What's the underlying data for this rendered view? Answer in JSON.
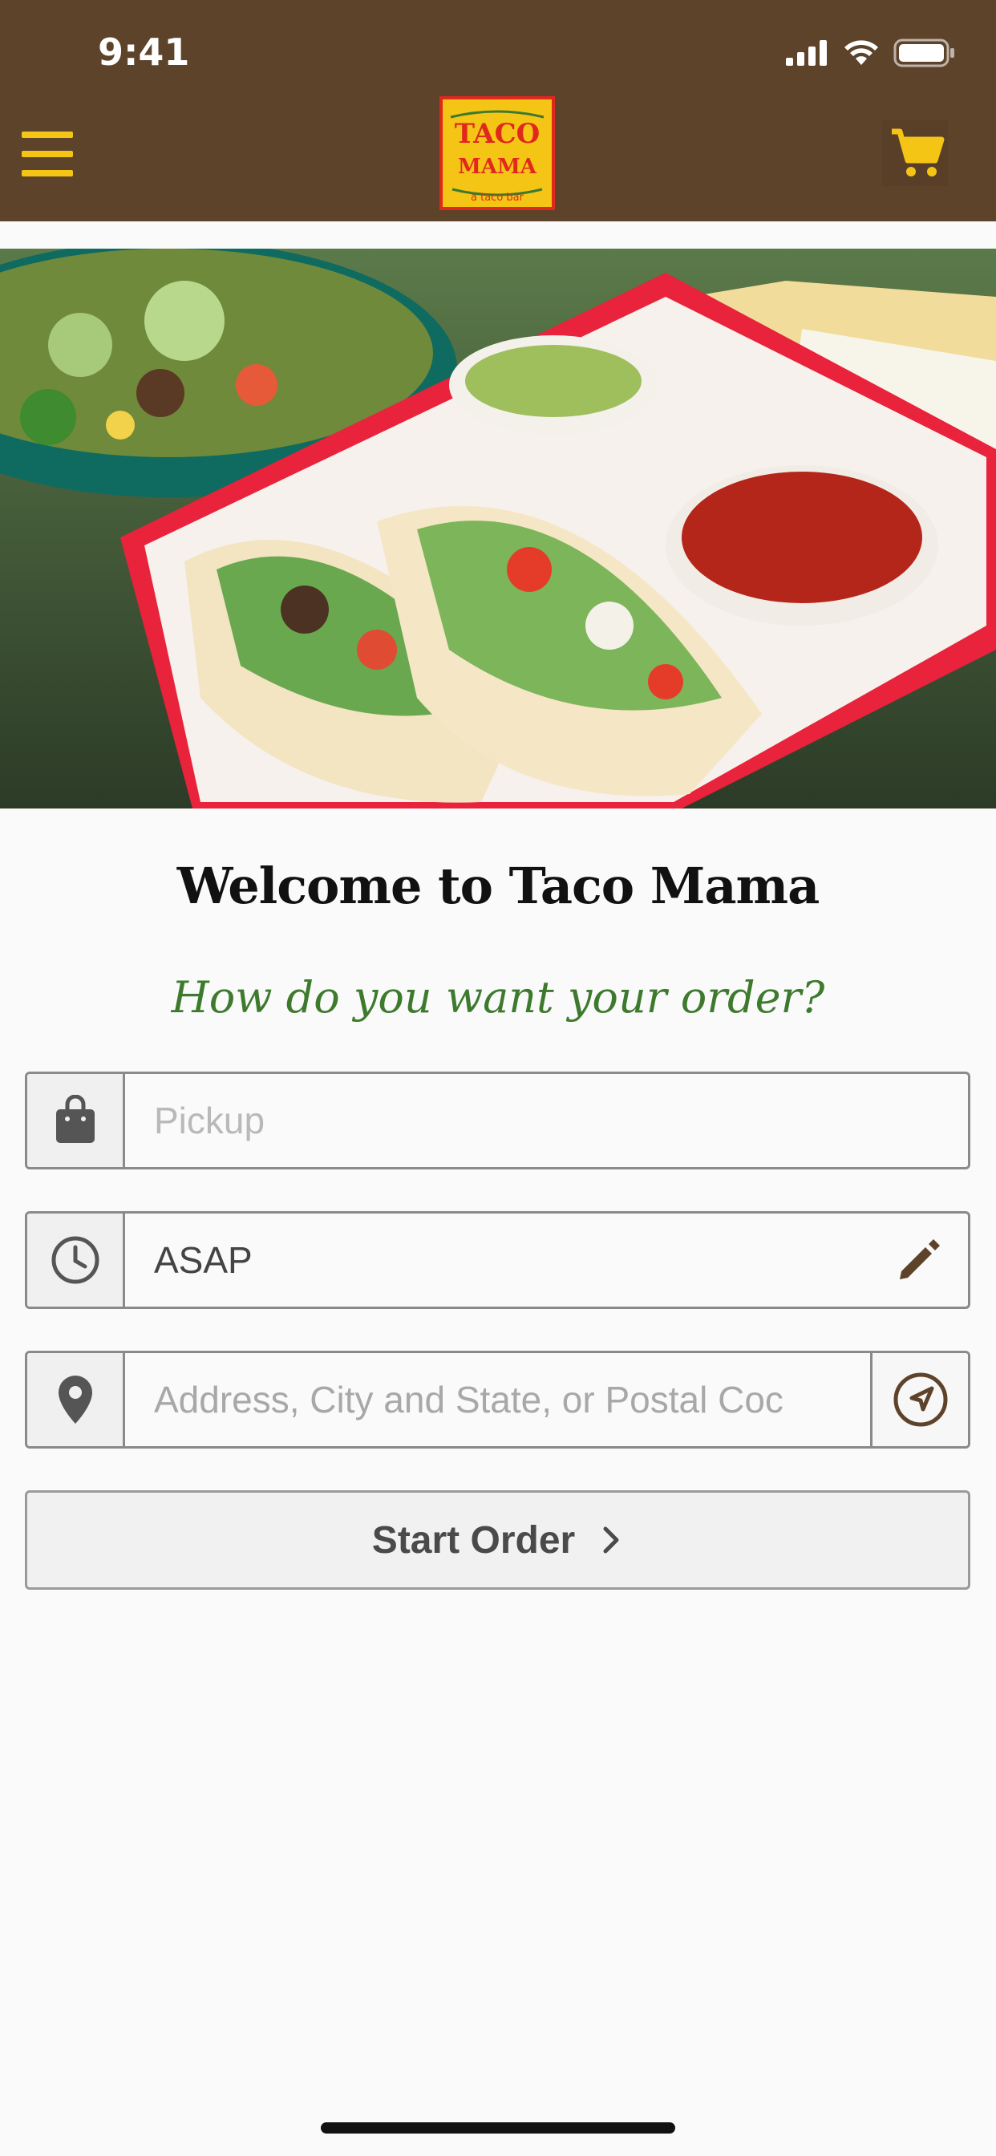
{
  "status_bar": {
    "time": "9:41"
  },
  "header": {
    "logo_line1": "TACO",
    "logo_line2": "MAMA",
    "logo_tagline": "a taco bar",
    "menu_icon": "hamburger-menu-icon",
    "cart_icon": "shopping-cart-icon"
  },
  "colors": {
    "header_bg": "#5e432b",
    "accent_yellow": "#f5c516",
    "subtitle_green": "#3e7a2d"
  },
  "welcome": {
    "title": "Welcome to Taco Mama",
    "subtitle": "How do you want your order?"
  },
  "form": {
    "order_type": {
      "placeholder": "Pickup",
      "icon": "shopping-bag-icon"
    },
    "time": {
      "value": "ASAP",
      "icon": "clock-icon",
      "edit_icon": "pencil-icon"
    },
    "address": {
      "placeholder": "Address, City and State, or Postal Coc",
      "icon": "map-pin-icon",
      "locate_icon": "navigation-arrow-icon"
    },
    "start_button": {
      "label": "Start Order",
      "icon": "chevron-right-icon"
    }
  }
}
